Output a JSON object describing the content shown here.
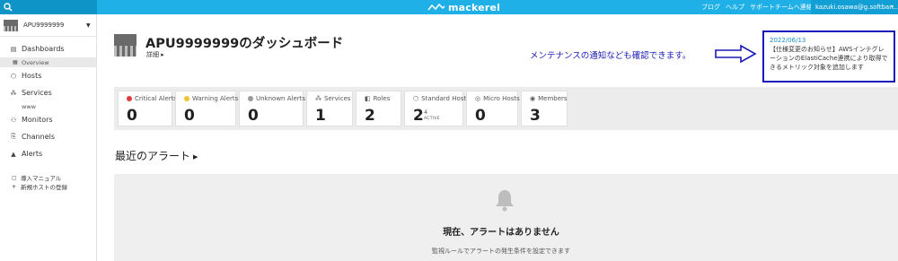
{
  "topbar": {
    "logo_text": "mackerel",
    "links": [
      "ブログ",
      "ヘルプ",
      "サポートチームへ連絡"
    ],
    "user": "kazuki.osawa@g.softban..."
  },
  "sidebar": {
    "org_name": "APU9999999",
    "items": [
      {
        "label": "Dashboards",
        "icon": "dashboard-icon"
      },
      {
        "label": "Overview",
        "icon": "grid-icon"
      },
      {
        "label": "Hosts",
        "icon": "hosts-icon"
      },
      {
        "label": "Services",
        "icon": "services-icon"
      },
      {
        "label": "www"
      },
      {
        "label": "Monitors",
        "icon": "monitors-icon"
      },
      {
        "label": "Channels",
        "icon": "channels-icon"
      },
      {
        "label": "Alerts",
        "icon": "bell-icon"
      }
    ],
    "extras": [
      {
        "label": "導入マニュアル",
        "icon": "document-icon"
      },
      {
        "label": "新規ホストの登録",
        "icon": "plus-icon"
      }
    ]
  },
  "header": {
    "title": "APU9999999のダッシュボード",
    "detail": "詳細 ▸"
  },
  "annotation": "メンテナンスの通知なども確認できます。",
  "notice": {
    "date": "2022/06/13",
    "text": "【仕様変更のお知らせ】AWSインテグレーションのElastiCache連携により取得できるメトリック対象を追加します"
  },
  "stats": [
    {
      "label": "Critical Alerts",
      "value": "0",
      "color": "#e03a3a"
    },
    {
      "label": "Warning Alerts",
      "value": "0",
      "color": "#f1c232"
    },
    {
      "label": "Unknown Alerts",
      "value": "0",
      "color": "#9a9a9a"
    },
    {
      "label": "Services",
      "value": "1"
    },
    {
      "label": "Roles",
      "value": "2"
    },
    {
      "label": "Standard Hosts",
      "value": "2",
      "sub_value": "4",
      "sub_label": "ACTIVE"
    },
    {
      "label": "Micro Hosts",
      "value": "0"
    },
    {
      "label": "Members",
      "value": "3"
    }
  ],
  "alerts": {
    "title": "最近のアラート",
    "empty_title": "現在、アラートはありません",
    "empty_sub": "監視ルールでアラートの発生条件を設定できます"
  },
  "colors": {
    "topbar": "#1fb0e8",
    "annotation": "#1a1ab8",
    "notice_date": "#1a8ec4"
  }
}
